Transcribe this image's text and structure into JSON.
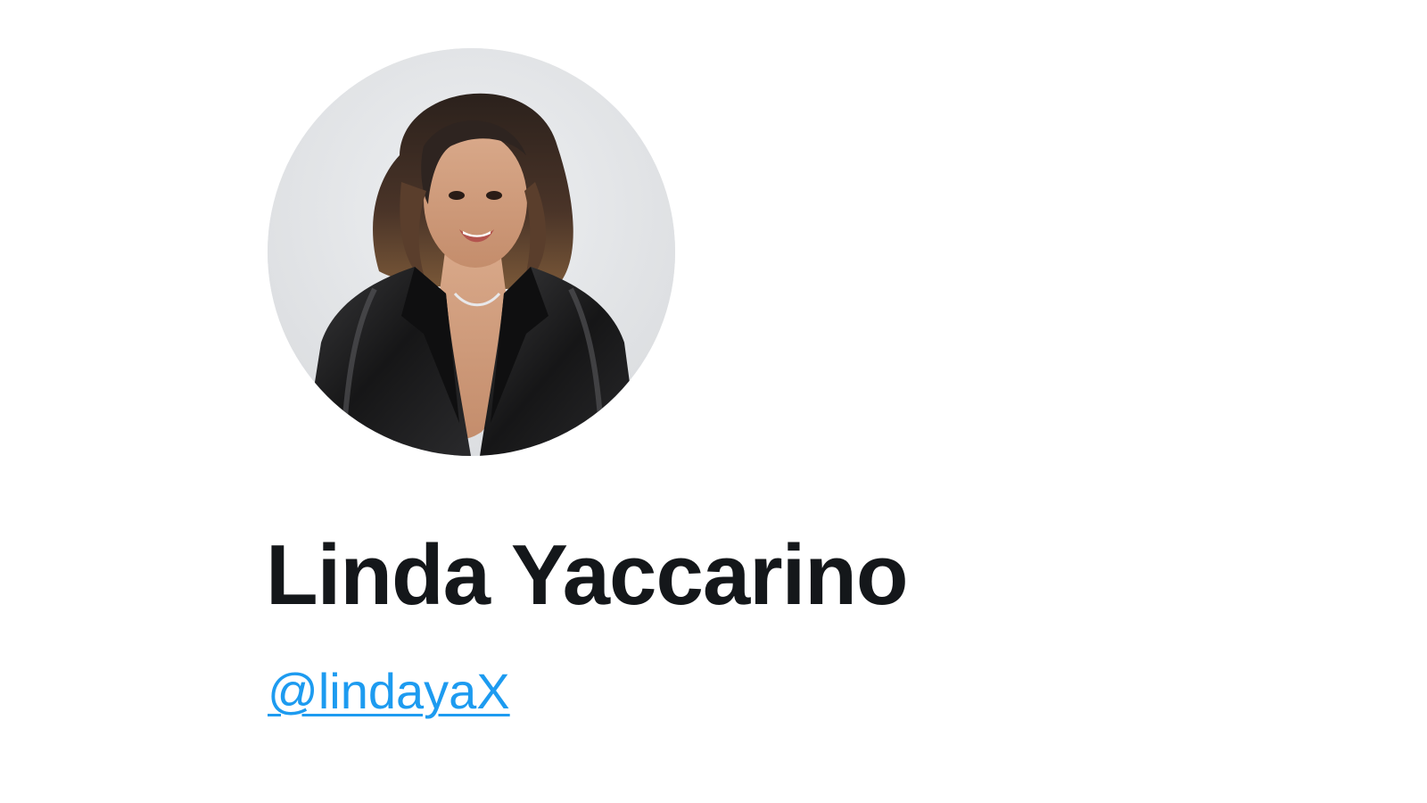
{
  "profile": {
    "display_name": "Linda Yaccarino",
    "handle": "@lindayaX",
    "avatar": {
      "icon": "profile-photo",
      "description_alt": "Linda Yaccarino"
    }
  },
  "colors": {
    "background": "#ffffff",
    "name_text": "#14171a",
    "link": "#1d9bf0",
    "avatar_bg": "#e6e7e9"
  }
}
